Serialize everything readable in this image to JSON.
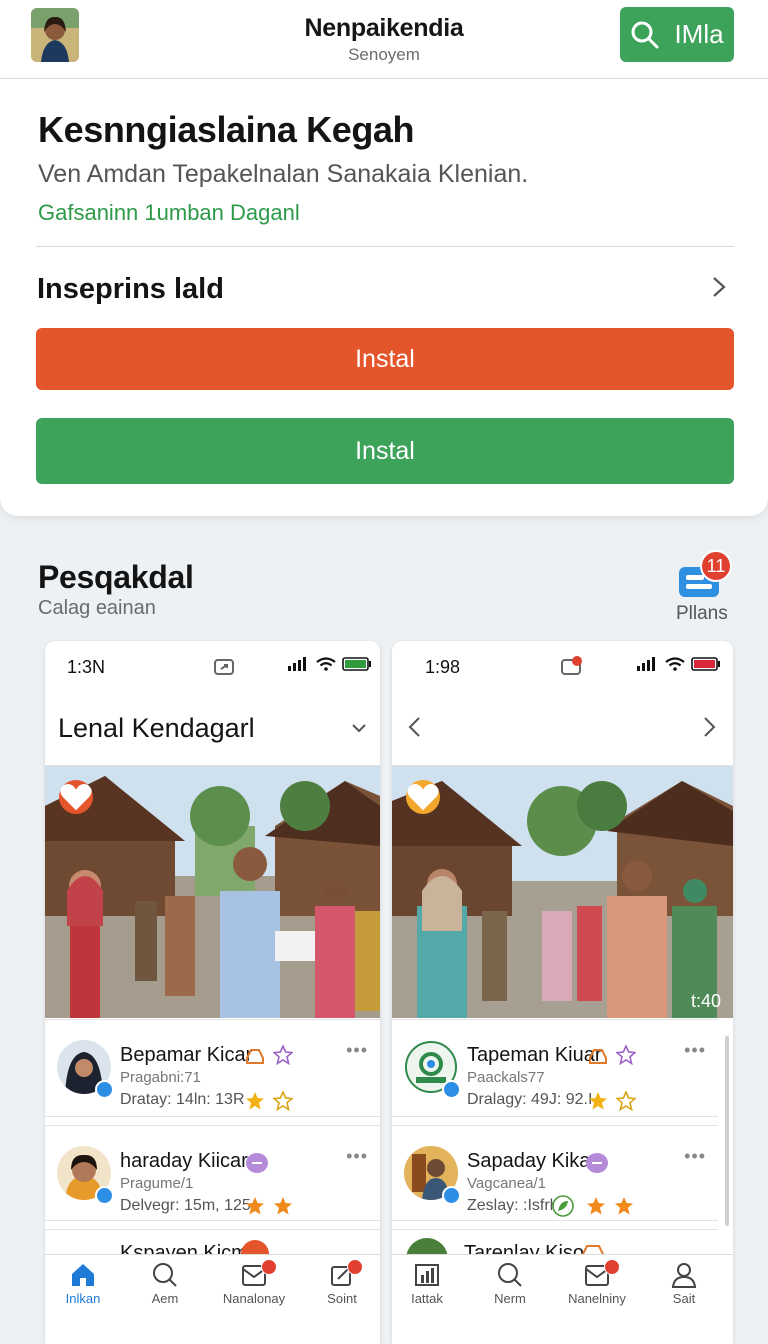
{
  "topbar": {
    "title": "Nenpaikendia",
    "subtitle": "Senoyem",
    "search_label": "IMla"
  },
  "install_card": {
    "heading": "Kesnngiaslaina Kegah",
    "description": "Ven Amdan Tepakelnalan Sanakaia Klenian.",
    "link": "Gafsaninn 1umban Daganl",
    "row_label": "Inseprins lald",
    "primary_button": "Instal",
    "secondary_button": "Instal",
    "colors": {
      "orange": "#e5552b",
      "green": "#3ea35a"
    }
  },
  "section": {
    "title": "Pesqakdal",
    "subtitle": "Calag eainan",
    "plans_label": "Pllans",
    "plans_badge": "11"
  },
  "phones": [
    {
      "time": "1:3Ν",
      "header_title": "Lenal Kendagarl",
      "cards": [
        {
          "name": "Bepamar Kicar",
          "meta1": "Pragabni:71",
          "meta2": "Dratay: 14ln: 13R"
        },
        {
          "name": "haraday Kiicar",
          "meta1": "Pragume/1",
          "meta2": "Delvegr: 15m, 125"
        },
        {
          "name": "Kspayen Kicm"
        }
      ],
      "nav": [
        {
          "label": "Inlkan",
          "icon": "home-icon",
          "active": true
        },
        {
          "label": "Aem",
          "icon": "search-icon"
        },
        {
          "label": "Nanalonay",
          "icon": "inbox-icon"
        },
        {
          "label": "Soint",
          "icon": "edit-icon"
        }
      ]
    },
    {
      "time": "1:98",
      "time_overlay": "t:40",
      "cards": [
        {
          "name": "Tapeman Kiuar",
          "meta1": "Paackals77",
          "meta2": "Dralagy: 49J: 92.I"
        },
        {
          "name": "Sapaday Kikar",
          "meta1": "Vagcanea/1",
          "meta2": "Zeslay: :Isfrh"
        },
        {
          "name": "Tarenlay Kiso"
        }
      ],
      "nav": [
        {
          "label": "Iattak",
          "icon": "chart-icon"
        },
        {
          "label": "Nerm",
          "icon": "search-icon"
        },
        {
          "label": "Nanelniny",
          "icon": "inbox-icon"
        },
        {
          "label": "Sait",
          "icon": "user-icon"
        }
      ]
    }
  ]
}
